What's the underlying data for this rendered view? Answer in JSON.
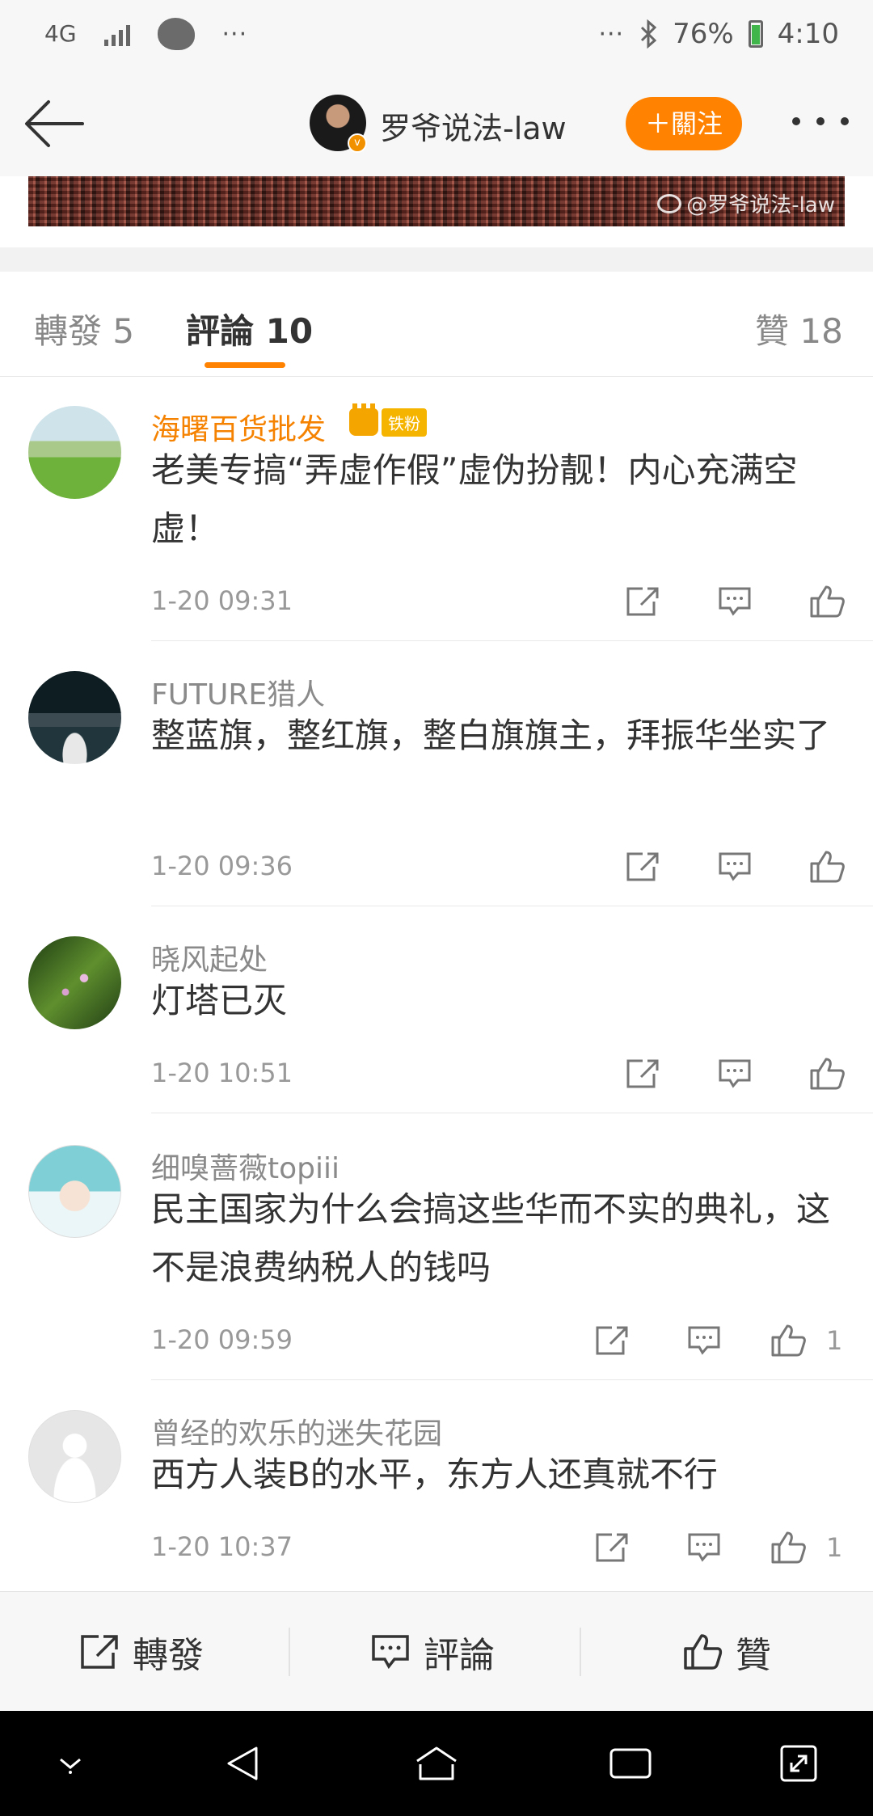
{
  "status_bar": {
    "network": "4G",
    "more": "···",
    "more_right": "···",
    "battery": "76%",
    "time": "4:10"
  },
  "header": {
    "title": "罗爷说法-law",
    "follow_label": "＋關注",
    "verified_badge": "v"
  },
  "image": {
    "watermark": "@罗爷说法-law"
  },
  "tabs": [
    {
      "label": "轉發 5"
    },
    {
      "label": "評論 10"
    },
    {
      "label": "贊 18"
    }
  ],
  "comments": [
    {
      "user": "海曙百货批发",
      "badge": "铁粉",
      "text": "老美专搞“弄虚作假”虚伪扮靓！内心充满空虚！",
      "time": "1-20 09:31",
      "likes": ""
    },
    {
      "user": "FUTURE猎人",
      "text": "整蓝旗，整红旗，整白旗旗主，拜振华坐实了",
      "time": "1-20 09:36",
      "likes": ""
    },
    {
      "user": "晓风起处",
      "text": "灯塔已灭",
      "time": "1-20 10:51",
      "likes": ""
    },
    {
      "user": "细嗅蔷薇topiii",
      "text": "民主国家为什么会搞这些华而不实的典礼，这不是浪费纳税人的钱吗",
      "time": "1-20 09:59",
      "likes": "1"
    },
    {
      "user": "曾经的欢乐的迷失花园",
      "text": "西方人装B的水平，东方人还真就不行",
      "time": "1-20 10:37",
      "likes": "1"
    }
  ],
  "bottom_bar": {
    "repost": "轉發",
    "comment": "評論",
    "like": "贊"
  },
  "colors": {
    "accent": "#ff8200",
    "vip_name": "#f58200",
    "text": "#333333",
    "meta": "#999999"
  }
}
